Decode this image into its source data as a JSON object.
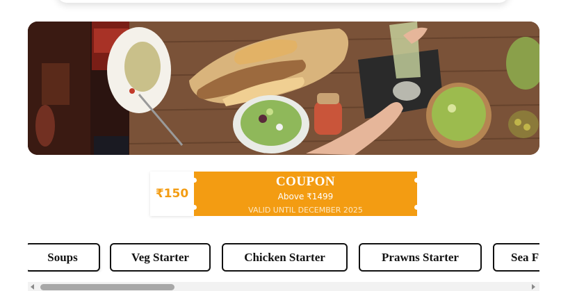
{
  "banner": {
    "image": "restaurant-table-food-photo"
  },
  "coupon": {
    "amount": "₹150",
    "title": "COUPON",
    "subtitle": "Above ₹1499",
    "validity": "VALID UNTIL DECEMBER 2025",
    "accent_color": "#f39c12"
  },
  "categories": {
    "tabs": [
      {
        "label": "Soups"
      },
      {
        "label": "Veg Starter"
      },
      {
        "label": "Chicken Starter"
      },
      {
        "label": "Prawns Starter"
      },
      {
        "label": "Sea F"
      }
    ]
  }
}
